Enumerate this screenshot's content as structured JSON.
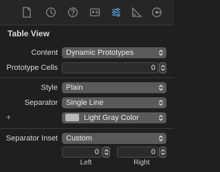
{
  "tabs": [
    {
      "icon": "file-inspector-icon"
    },
    {
      "icon": "history-inspector-icon"
    },
    {
      "icon": "quick-help-icon"
    },
    {
      "icon": "identity-inspector-icon"
    },
    {
      "icon": "attributes-inspector-icon"
    },
    {
      "icon": "size-inspector-icon"
    },
    {
      "icon": "connections-inspector-icon"
    }
  ],
  "section": {
    "title": "Table View"
  },
  "content": {
    "label": "Content",
    "value": "Dynamic Prototypes"
  },
  "prototype_cells": {
    "label": "Prototype Cells",
    "value": "0"
  },
  "style": {
    "label": "Style",
    "value": "Plain"
  },
  "separator": {
    "label": "Separator",
    "value": "Single Line"
  },
  "separator_color": {
    "plus": "+",
    "value": "Light Gray Color",
    "swatch_color": "#b8b8b8"
  },
  "separator_inset": {
    "label": "Separator Inset",
    "value": "Custom",
    "left": {
      "value": "0",
      "label": "Left"
    },
    "right": {
      "value": "0",
      "label": "Right"
    }
  },
  "colors": {
    "accent": "#5a9fe0",
    "background": "#1f1f1f"
  }
}
